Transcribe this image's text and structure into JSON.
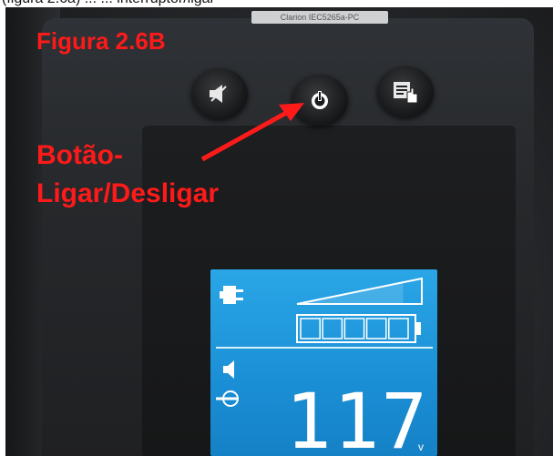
{
  "top_caption": "(figura 2.6a) ... ... interruptor/ligar",
  "model_label": "Clarion  IEC5265a-PC",
  "figure_title": "Figura 2.6B",
  "callout": {
    "line1": "Botão-",
    "line2": "Ligar/Desligar"
  },
  "buttons": [
    {
      "name": "mute",
      "icon": "speaker-mute-icon"
    },
    {
      "name": "power",
      "icon": "power-icon"
    },
    {
      "name": "menu",
      "icon": "menu-hand-icon"
    }
  ],
  "lcd": {
    "reading": "117",
    "unit": "v",
    "load_level": 0.85,
    "battery_segments": 5
  },
  "colors": {
    "annotation": "#ff1a1a",
    "lcd": "#1b8fd6"
  }
}
